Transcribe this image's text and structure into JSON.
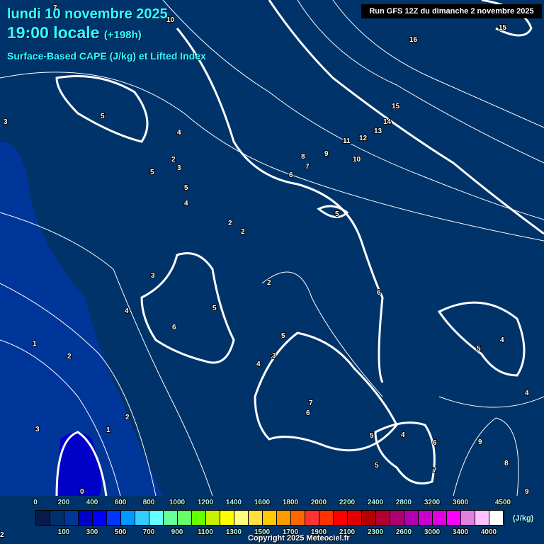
{
  "header": {
    "date": "lundi 10 novembre 2025",
    "time": "19:00 locale",
    "lead": "(+198h)",
    "parameter": "Surface-Based CAPE (J/kg) et Lifted Index",
    "run": "Run GFS 12Z du dimanche 2 novembre 2025"
  },
  "colorbar": {
    "top_labels": [
      "0",
      "200",
      "400",
      "600",
      "800",
      "1000",
      "1200",
      "1400",
      "1600",
      "1800",
      "2000",
      "2200",
      "2400",
      "2800",
      "3200",
      "3600",
      "4500"
    ],
    "bottom_labels": [
      "100",
      "300",
      "500",
      "700",
      "900",
      "1100",
      "1300",
      "1500",
      "1700",
      "1900",
      "2100",
      "2300",
      "2600",
      "3000",
      "3400",
      "4000"
    ],
    "colors": [
      "#0a1a4a",
      "#00306a",
      "#00369a",
      "#0000c8",
      "#0000ff",
      "#0035ff",
      "#0099ff",
      "#33ccff",
      "#66ffff",
      "#66ff99",
      "#66ff66",
      "#66ff00",
      "#c8f000",
      "#ffff00",
      "#ffff80",
      "#ffe040",
      "#ffc800",
      "#ff9900",
      "#ff6600",
      "#ff3333",
      "#ff3300",
      "#ff0000",
      "#e00000",
      "#b40000",
      "#b00030",
      "#b00070",
      "#b000b0",
      "#cc00cc",
      "#e000e0",
      "#ff00ff",
      "#e080e0",
      "#ffc0ff",
      "#ffffff"
    ],
    "unit": "(J/kg)"
  },
  "li_labels": [
    "7",
    "10",
    "15",
    "16",
    "3",
    "5",
    "4",
    "2",
    "3",
    "5",
    "5",
    "4",
    "2",
    "2",
    "3",
    "4",
    "6",
    "5",
    "2",
    "1",
    "2",
    "3",
    "1",
    "2",
    "3",
    "0",
    "8",
    "7",
    "6",
    "9",
    "11",
    "12",
    "13",
    "14",
    "15",
    "5",
    "10",
    "6",
    "5",
    "4",
    "3",
    "4",
    "7",
    "6",
    "5",
    "4",
    "5",
    "6",
    "7",
    "9",
    "8",
    "9",
    "5",
    "2",
    "4"
  ],
  "copyright": "Copyright 2025 Meteociel.fr",
  "colors": {
    "background": "#00336a",
    "title": "#33ffff"
  }
}
